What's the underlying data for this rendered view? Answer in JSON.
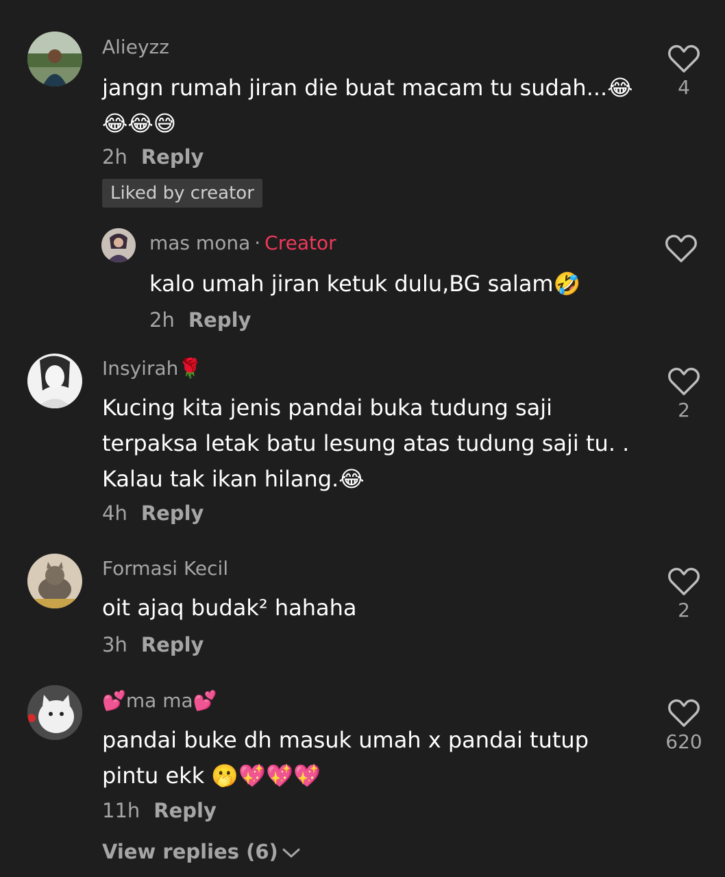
{
  "comments": [
    {
      "username": "Alieyzz",
      "text_lines": [
        "jangn rumah jiran die buat macam tu sudah...😂",
        "😂😂😅"
      ],
      "time": "2h",
      "reply_label": "Reply",
      "badge": "Liked by creator",
      "likes": "4"
    },
    {
      "username": "mas mona",
      "creator_label": "Creator",
      "separator": "·",
      "text_lines": [
        "kalo umah jiran ketuk dulu,BG salam🤣"
      ],
      "time": "2h",
      "reply_label": "Reply"
    },
    {
      "username": "Insyirah🌹",
      "text_lines": [
        "Kucing kita jenis pandai buka tudung saji",
        "terpaksa letak batu lesung atas tudung saji tu. .",
        "Kalau tak ikan hilang.😂"
      ],
      "time": "4h",
      "reply_label": "Reply",
      "likes": "2"
    },
    {
      "username": "Formasi Kecil",
      "text_lines": [
        "oit ajaq budak² hahaha"
      ],
      "time": "3h",
      "reply_label": "Reply",
      "likes": "2"
    },
    {
      "username": "💕ma ma💕",
      "text_lines": [
        "pandai buke dh masuk umah x pandai tutup",
        "pintu ekk 🫢💖💖💖"
      ],
      "time": "11h",
      "reply_label": "Reply",
      "likes": "620"
    }
  ],
  "view_replies": "View replies (6)",
  "colors": {
    "background": "#1e1e1e",
    "secondary_text": "#a6a6a6",
    "creator_accent": "#f2385a"
  },
  "icons": {
    "like": "heart-outline-icon",
    "expand": "chevron-down-icon"
  }
}
